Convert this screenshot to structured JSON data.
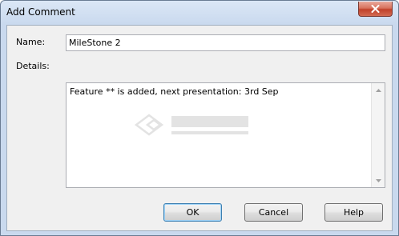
{
  "window": {
    "title": "Add Comment"
  },
  "icons": {
    "close": "close-icon",
    "scroll_up": "scroll-up-arrow-icon",
    "scroll_down": "scroll-down-arrow-icon"
  },
  "form": {
    "name_label": "Name:",
    "name_value": "MileStone 2",
    "details_label": "Details:",
    "details_value": "Feature ** is added, next presentation: 3rd Sep"
  },
  "buttons": {
    "ok": "OK",
    "cancel": "Cancel",
    "help": "Help"
  },
  "colors": {
    "title_bar": "#c9d9ee",
    "close_button": "#c1412a",
    "dialog_background": "#f0f0f0"
  }
}
